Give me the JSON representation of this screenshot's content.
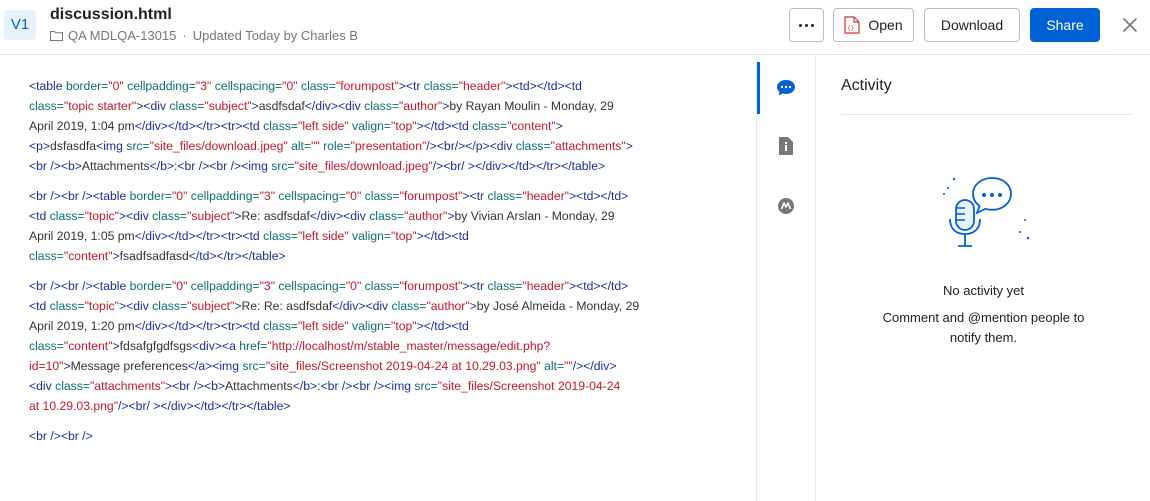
{
  "header": {
    "version_badge": "V1",
    "file_name": "discussion.html",
    "folder_name": "QA MDLQA-13015",
    "separator": "·",
    "updated_text": "Updated Today by Charles B",
    "open_label": "Open",
    "download_label": "Download",
    "share_label": "Share",
    "accent_color": "#0061d5"
  },
  "code_blocks": [
    {
      "lines": [
        [
          [
            "tg",
            "<table "
          ],
          [
            "at",
            "border="
          ],
          [
            "vl",
            "\"0\""
          ],
          [
            "at",
            " cellpadding="
          ],
          [
            "vl",
            "\"3\""
          ],
          [
            "at",
            " cellspacing="
          ],
          [
            "vl",
            "\"0\""
          ],
          [
            "at",
            " class="
          ],
          [
            "vl",
            "\"forumpost\""
          ],
          [
            "tg",
            "><tr "
          ],
          [
            "at",
            "class="
          ],
          [
            "vl",
            "\"header\""
          ],
          [
            "tg",
            "><td></td><td"
          ]
        ],
        [
          [
            "at",
            "class="
          ],
          [
            "vl",
            "\"topic starter\""
          ],
          [
            "tg",
            "><div "
          ],
          [
            "at",
            "class="
          ],
          [
            "vl",
            "\"subject\""
          ],
          [
            "tg",
            ">"
          ],
          [
            "tx",
            "asdfsdaf"
          ],
          [
            "tg",
            "</div><div "
          ],
          [
            "at",
            "class="
          ],
          [
            "vl",
            "\"author\""
          ],
          [
            "tg",
            ">"
          ],
          [
            "tx",
            "by Rayan Moulin - Monday, 29"
          ]
        ],
        [
          [
            "tx",
            "April 2019, 1:04 pm"
          ],
          [
            "tg",
            "</div></td></tr><tr><td "
          ],
          [
            "at",
            "class="
          ],
          [
            "vl",
            "\"left side\""
          ],
          [
            "at",
            " valign="
          ],
          [
            "vl",
            "\"top\""
          ],
          [
            "tg",
            "></td><td "
          ],
          [
            "at",
            "class="
          ],
          [
            "vl",
            "\"content\""
          ],
          [
            "tg",
            ">"
          ]
        ],
        [
          [
            "tg",
            "<p>"
          ],
          [
            "tx",
            "dsfasdfa"
          ],
          [
            "tg",
            "<img "
          ],
          [
            "at",
            "src="
          ],
          [
            "vl",
            "\"site_files/download.jpeg\""
          ],
          [
            "at",
            " alt="
          ],
          [
            "vl",
            "\"\""
          ],
          [
            "at",
            " role="
          ],
          [
            "vl",
            "\"presentation\""
          ],
          [
            "tg",
            "/><br/></p><div "
          ],
          [
            "at",
            "class="
          ],
          [
            "vl",
            "\"attachments\""
          ],
          [
            "tg",
            ">"
          ]
        ],
        [
          [
            "tg",
            "<br /><b>"
          ],
          [
            "tx",
            "Attachments"
          ],
          [
            "tg",
            "</b>"
          ],
          [
            "tx",
            ":"
          ],
          [
            "tg",
            "<br /><br /><img "
          ],
          [
            "at",
            "src="
          ],
          [
            "vl",
            "\"site_files/download.jpeg\""
          ],
          [
            "tg",
            "/><br/ ></div></td></tr></table>"
          ]
        ]
      ]
    },
    {
      "lines": [
        [
          [
            "tg",
            "<br /><br /><table "
          ],
          [
            "at",
            "border="
          ],
          [
            "vl",
            "\"0\""
          ],
          [
            "at",
            " cellpadding="
          ],
          [
            "vl",
            "\"3\""
          ],
          [
            "at",
            " cellspacing="
          ],
          [
            "vl",
            "\"0\""
          ],
          [
            "at",
            " class="
          ],
          [
            "vl",
            "\"forumpost\""
          ],
          [
            "tg",
            "><tr "
          ],
          [
            "at",
            "class="
          ],
          [
            "vl",
            "\"header\""
          ],
          [
            "tg",
            "><td></td>"
          ]
        ],
        [
          [
            "tg",
            "<td "
          ],
          [
            "at",
            "class="
          ],
          [
            "vl",
            "\"topic\""
          ],
          [
            "tg",
            "><div "
          ],
          [
            "at",
            "class="
          ],
          [
            "vl",
            "\"subject\""
          ],
          [
            "tg",
            ">"
          ],
          [
            "tx",
            "Re: asdfsdaf"
          ],
          [
            "tg",
            "</div><div "
          ],
          [
            "at",
            "class="
          ],
          [
            "vl",
            "\"author\""
          ],
          [
            "tg",
            ">"
          ],
          [
            "tx",
            "by Vivian Arslan - Monday, 29"
          ]
        ],
        [
          [
            "tx",
            "April 2019, 1:05 pm"
          ],
          [
            "tg",
            "</div></td></tr><tr><td "
          ],
          [
            "at",
            "class="
          ],
          [
            "vl",
            "\"left side\""
          ],
          [
            "at",
            " valign="
          ],
          [
            "vl",
            "\"top\""
          ],
          [
            "tg",
            "></td><td"
          ]
        ],
        [
          [
            "at",
            "class="
          ],
          [
            "vl",
            "\"content\""
          ],
          [
            "tg",
            ">"
          ],
          [
            "tx",
            "fsadfsadfasd"
          ],
          [
            "tg",
            "</td></tr></table>"
          ]
        ]
      ]
    },
    {
      "lines": [
        [
          [
            "tg",
            "<br /><br /><table "
          ],
          [
            "at",
            "border="
          ],
          [
            "vl",
            "\"0\""
          ],
          [
            "at",
            " cellpadding="
          ],
          [
            "vl",
            "\"3\""
          ],
          [
            "at",
            " cellspacing="
          ],
          [
            "vl",
            "\"0\""
          ],
          [
            "at",
            " class="
          ],
          [
            "vl",
            "\"forumpost\""
          ],
          [
            "tg",
            "><tr "
          ],
          [
            "at",
            "class="
          ],
          [
            "vl",
            "\"header\""
          ],
          [
            "tg",
            "><td></td>"
          ]
        ],
        [
          [
            "tg",
            "<td "
          ],
          [
            "at",
            "class="
          ],
          [
            "vl",
            "\"topic\""
          ],
          [
            "tg",
            "><div "
          ],
          [
            "at",
            "class="
          ],
          [
            "vl",
            "\"subject\""
          ],
          [
            "tg",
            ">"
          ],
          [
            "tx",
            "Re: Re: asdfsdaf"
          ],
          [
            "tg",
            "</div><div "
          ],
          [
            "at",
            "class="
          ],
          [
            "vl",
            "\"author\""
          ],
          [
            "tg",
            ">"
          ],
          [
            "tx",
            "by José Almeida - Monday, 29"
          ]
        ],
        [
          [
            "tx",
            "April 2019, 1:20 pm"
          ],
          [
            "tg",
            "</div></td></tr><tr><td "
          ],
          [
            "at",
            "class="
          ],
          [
            "vl",
            "\"left side\""
          ],
          [
            "at",
            " valign="
          ],
          [
            "vl",
            "\"top\""
          ],
          [
            "tg",
            "></td><td"
          ]
        ],
        [
          [
            "at",
            "class="
          ],
          [
            "vl",
            "\"content\""
          ],
          [
            "tg",
            ">"
          ],
          [
            "tx",
            "fdsafgfgdfsgs"
          ],
          [
            "tg",
            "<div><a "
          ],
          [
            "at",
            "href="
          ],
          [
            "vl",
            "\"http://localhost/m/stable_master/message/edit.php?"
          ]
        ],
        [
          [
            "vl",
            "id=10\""
          ],
          [
            "tg",
            ">"
          ],
          [
            "tx",
            "Message preferences"
          ],
          [
            "tg",
            "</a><img "
          ],
          [
            "at",
            "src="
          ],
          [
            "vl",
            "\"site_files/Screenshot 2019-04-24 at 10.29.03.png\""
          ],
          [
            "at",
            " alt="
          ],
          [
            "vl",
            "\"\""
          ],
          [
            "tg",
            "/></div>"
          ]
        ],
        [
          [
            "tg",
            "<div "
          ],
          [
            "at",
            "class="
          ],
          [
            "vl",
            "\"attachments\""
          ],
          [
            "tg",
            "><br /><b>"
          ],
          [
            "tx",
            "Attachments"
          ],
          [
            "tg",
            "</b>"
          ],
          [
            "tx",
            ":"
          ],
          [
            "tg",
            "<br /><br /><img "
          ],
          [
            "at",
            "src="
          ],
          [
            "vl",
            "\"site_files/Screenshot 2019-04-24"
          ]
        ],
        [
          [
            "vl",
            "at 10.29.03.png\""
          ],
          [
            "tg",
            "/><br/ ></div></td></tr></table>"
          ]
        ]
      ]
    },
    {
      "lines": [
        [
          [
            "tg",
            "<br /><br />"
          ]
        ]
      ]
    }
  ],
  "sidebar": {
    "items": [
      {
        "icon": "comment-icon",
        "active": true
      },
      {
        "icon": "file-info-icon",
        "active": false
      },
      {
        "icon": "metadata-icon",
        "active": false
      }
    ]
  },
  "activity": {
    "title": "Activity",
    "empty_title": "No activity yet",
    "empty_body": "Comment and @mention people to notify them."
  }
}
